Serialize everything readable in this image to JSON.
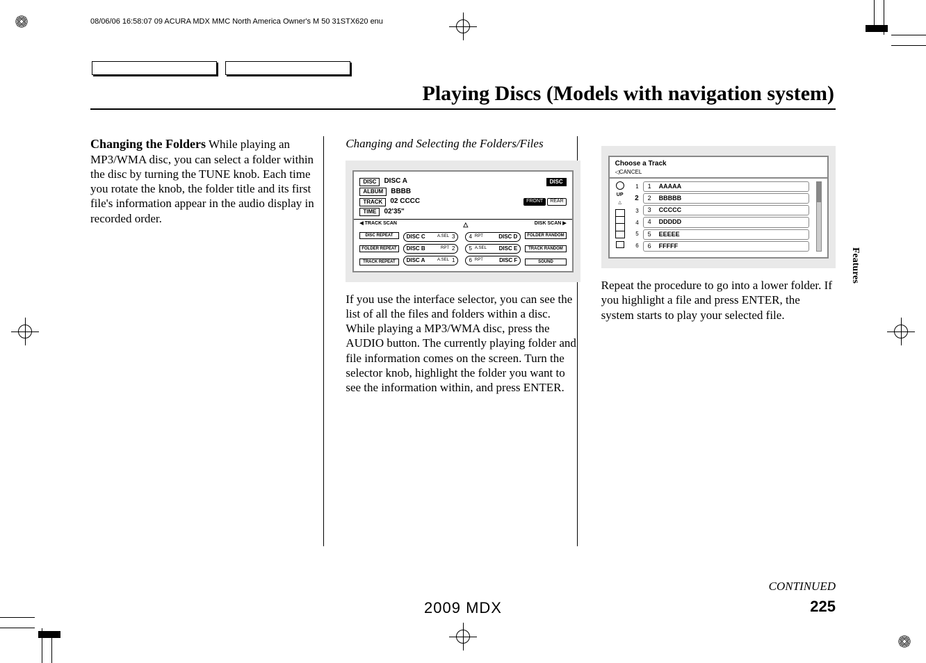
{
  "header_text": "08/06/06 16:58:07   09 ACURA MDX MMC North America Owner's M 50 31STX620 enu",
  "page_title": "Playing Discs (Models with navigation system)",
  "section_tab": "Features",
  "col1": {
    "heading": "Changing the Folders",
    "body": "While playing an MP3/WMA disc, you can select a folder within the disc by turning the TUNE knob. Each time you rotate the knob, the folder title and its first file's information appear in the audio display in recorded order."
  },
  "col2": {
    "heading": "Changing and Selecting the Folders/Files",
    "body": "If you use the interface selector, you can see the list of all the files and folders within a disc. While playing a MP3/WMA disc, press the AUDIO button. The currently playing folder and file information comes on the screen. Turn the selector knob, highlight the folder you want to see the information within, and press ENTER.",
    "figure": {
      "disc_label": "DISC",
      "disc_value": "DISC A",
      "album_label": "ALBUM",
      "album_value": "BBBB",
      "track_label": "TRACK",
      "track_value": "02  CCCC",
      "time_label": "TIME",
      "time_value": "02'35\"",
      "disc_badge": "DISC",
      "front": "FRONT",
      "rear": "REAR",
      "track_scan": "◀ TRACK SCAN",
      "disk_scan": "DISK SCAN ▶",
      "side_left": [
        "DISC REPEAT",
        "FOLDER REPEAT",
        "TRACK REPEAT"
      ],
      "side_right": [
        "FOLDER RANDOM",
        "TRACK RANDOM",
        "SOUND"
      ],
      "presets_left": [
        "DISC C",
        "DISC B",
        "DISC A"
      ],
      "presets_right": [
        "DISC D",
        "DISC E",
        "DISC F"
      ],
      "preset_nums_left": [
        "3",
        "2",
        "1"
      ],
      "preset_nums_right": [
        "4",
        "5",
        "6"
      ]
    }
  },
  "col3": {
    "body": "Repeat the procedure to go into a lower folder. If you highlight a file and press ENTER, the system starts to play your selected file.",
    "figure": {
      "title": "Choose  a  Track",
      "cancel": "◁CANCEL",
      "up": "UP",
      "highlight_index": "2",
      "indices": [
        "1",
        "2",
        "3",
        "4",
        "5",
        "6"
      ],
      "items": [
        {
          "n": "1",
          "label": "AAAAA"
        },
        {
          "n": "2",
          "label": "BBBBB"
        },
        {
          "n": "3",
          "label": "CCCCC"
        },
        {
          "n": "4",
          "label": "DDDDD"
        },
        {
          "n": "5",
          "label": "EEEEE"
        },
        {
          "n": "6",
          "label": "FFFFF"
        }
      ]
    }
  },
  "continued": "CONTINUED",
  "page_number": "225",
  "model_year": "2009  MDX"
}
